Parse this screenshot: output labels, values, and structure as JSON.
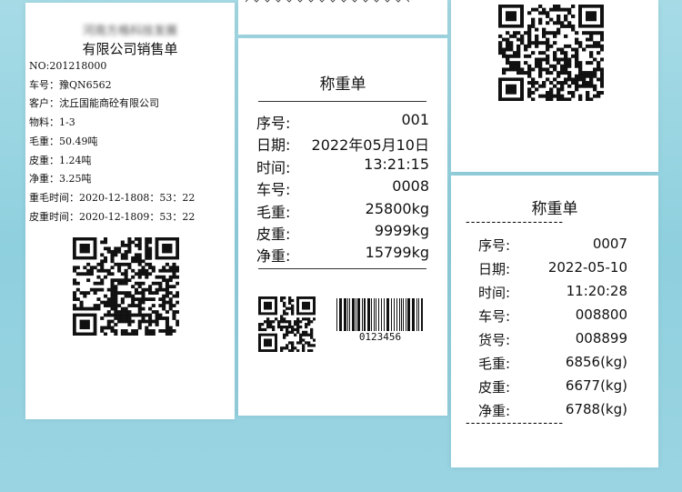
{
  "receipt_left": {
    "company_line1": "河南方格科技发展",
    "company_line2": "有限公司销售单",
    "lines": [
      "NO:201218000",
      "车号：豫QN6562",
      "客户：沈丘国能商砼有限公司",
      "物料：1-3",
      "毛重：50.49吨",
      "皮重：1.24吨",
      "净重：3.25吨",
      "重毛时间：2020-12-1808：53：22",
      "皮重时间：2020-12-1809：53：22"
    ]
  },
  "receipt_middle": {
    "title": "称重单",
    "rows": [
      {
        "label": "序号:",
        "value": "001"
      },
      {
        "label": "日期:",
        "value": "2022年05月10日"
      },
      {
        "label": "时间:",
        "value": "13:21:15"
      },
      {
        "label": "车号:",
        "value": "0008"
      },
      {
        "label": "毛重:",
        "value": "25800kg"
      },
      {
        "label": "皮重:",
        "value": "9999kg"
      },
      {
        "label": "净重:",
        "value": "15799kg"
      }
    ],
    "barcode_text": "0123456"
  },
  "receipt_right": {
    "title": "称重单",
    "dashes": "-------------------",
    "rows": [
      {
        "label": "序号:",
        "value": "0007"
      },
      {
        "label": "日期:",
        "value": "2022-05-10"
      },
      {
        "label": "时间:",
        "value": "11:20:28"
      },
      {
        "label": "车号:",
        "value": "008800"
      },
      {
        "label": "货号:",
        "value": "008899"
      },
      {
        "label": "毛重:",
        "value": "6856(kg)"
      },
      {
        "label": "皮重:",
        "value": "6677(kg)"
      },
      {
        "label": "净重:",
        "value": "6788(kg)"
      }
    ]
  },
  "colors": {
    "background": "#9fd6e3",
    "paper": "#ffffff",
    "ink": "#111111"
  }
}
